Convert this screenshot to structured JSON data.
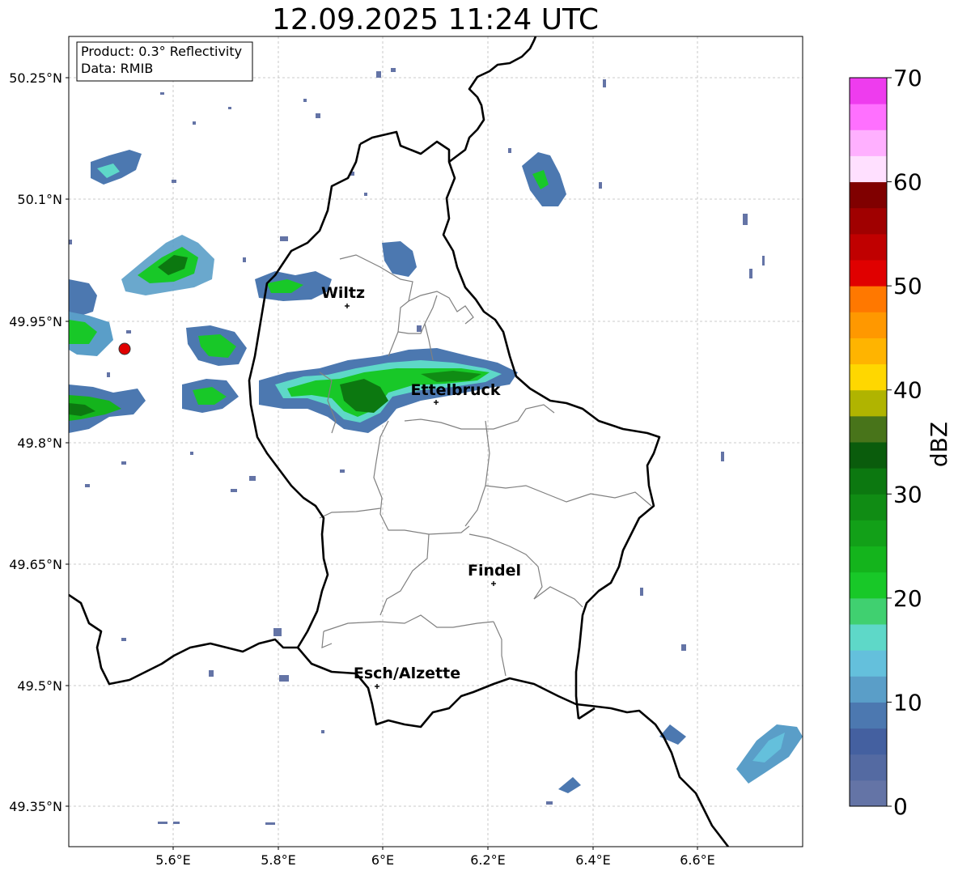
{
  "title": "12.09.2025 11:24 UTC",
  "info_box": {
    "line1": "Product: 0.3° Reflectivity",
    "line2": "Data: RMIB"
  },
  "axes": {
    "x_ticks": [
      "5.6°E",
      "5.8°E",
      "6°E",
      "6.2°E",
      "6.4°E",
      "6.6°E"
    ],
    "y_ticks": [
      "50.25°N",
      "50.1°N",
      "49.95°N",
      "49.8°N",
      "49.65°N",
      "49.5°N",
      "49.35°N"
    ]
  },
  "cities": [
    {
      "name": "Wiltz"
    },
    {
      "name": "Ettelbruck"
    },
    {
      "name": "Findel"
    },
    {
      "name": "Esch/Alzette"
    }
  ],
  "colorbar": {
    "label": "dBZ",
    "ticks": [
      "0",
      "10",
      "20",
      "30",
      "40",
      "50",
      "60",
      "70"
    ],
    "colors": [
      "#6474a6",
      "#546aa2",
      "#4460a0",
      "#4c78b0",
      "#5a9ec8",
      "#64c0dc",
      "#5ed8c8",
      "#40d070",
      "#18c828",
      "#14b41c",
      "#12a018",
      "#108c14",
      "#0c7810",
      "#0a5c0c",
      "#48741a",
      "#b0b400",
      "#ffd700",
      "#ffb400",
      "#ff9800",
      "#ff7800",
      "#e00000",
      "#c00000",
      "#a00000",
      "#800000",
      "#ffe0ff",
      "#ffb0ff",
      "#ff70ff",
      "#ee3cee"
    ]
  },
  "markers": {
    "radar_site_color": "#e00000"
  }
}
